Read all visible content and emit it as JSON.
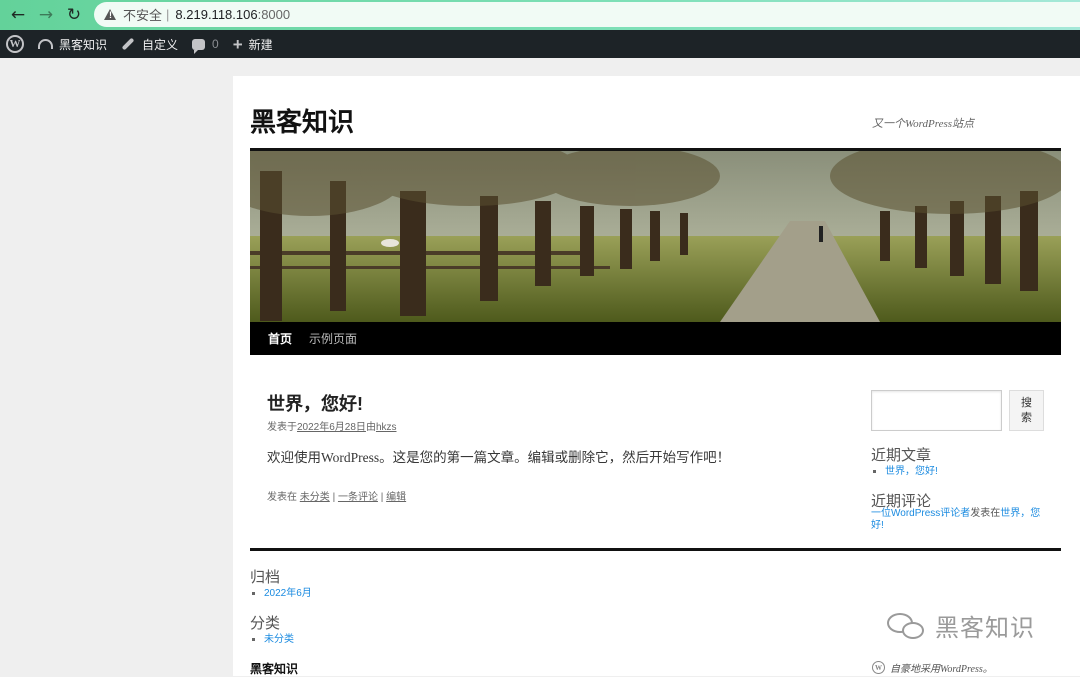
{
  "browser": {
    "insecure_label": "不安全",
    "separator": "|",
    "host": "8.219.118.106",
    "port": ":8000"
  },
  "adminbar": {
    "site_name": "黑客知识",
    "customize": "自定义",
    "comments_count": "0",
    "new": "新建"
  },
  "header": {
    "site_title": "黑客知识",
    "site_description": "又一个WordPress站点",
    "menu": [
      "首页",
      "示例页面"
    ]
  },
  "post": {
    "title": "世界，您好!",
    "meta_prefix": "发表于",
    "date": "2022年6月28日",
    "by": "由",
    "author": "hkzs",
    "content": "欢迎使用WordPress。这是您的第一篇文章。编辑或删除它，然后开始写作吧！",
    "footer_prefix": "发表在",
    "category": "未分类",
    "pipe": "|",
    "comment_link": "一条评论",
    "edit_link": "编辑"
  },
  "sidebar": {
    "search_button": "搜索",
    "recent_posts_title": "近期文章",
    "recent_posts": [
      "世界，您好!"
    ],
    "recent_comments_title": "近期评论",
    "comment_author": "一位WordPress评论者",
    "comment_on": "发表在",
    "comment_post": "世界，您好!"
  },
  "footer_widgets": {
    "archives_title": "归档",
    "archives": [
      "2022年6月"
    ],
    "categories_title": "分类",
    "categories": [
      "未分类"
    ]
  },
  "footer": {
    "site_name": "黑客知识",
    "credit": "自豪地采用WordPress。"
  },
  "watermark": {
    "text": "黑客知识"
  },
  "colors": {
    "link": "#1b8be0",
    "adminbar": "#1d2327",
    "browser_accent": "#63d29a"
  }
}
